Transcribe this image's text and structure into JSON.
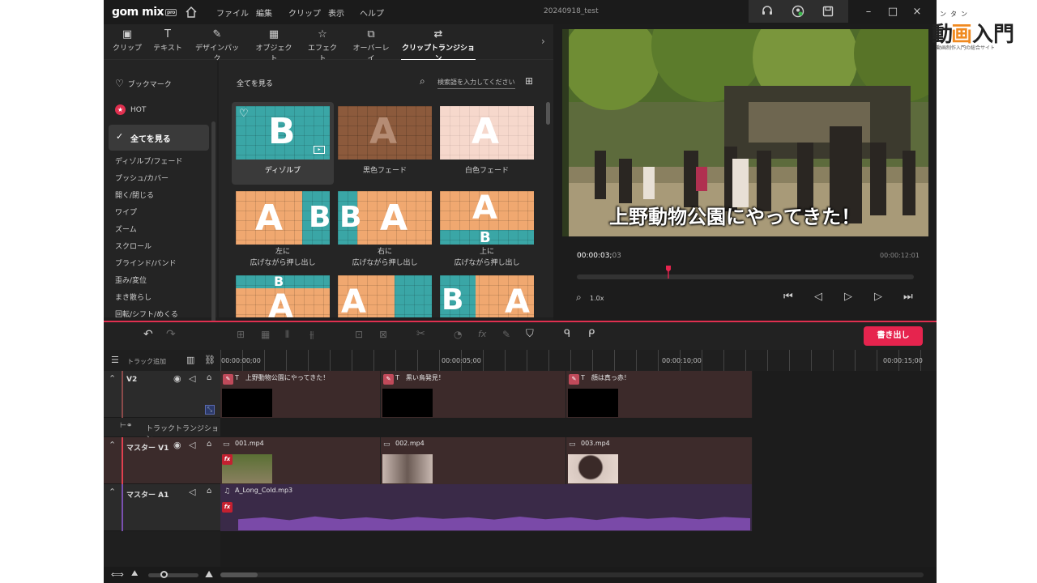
{
  "app": {
    "logo": "gom mix",
    "logo_badge": "pro",
    "project_name": "20240918_test"
  },
  "menu": [
    "ファイル",
    "編集",
    "クリップ",
    "表示",
    "ヘルプ"
  ],
  "tabs": [
    {
      "label": "クリップ",
      "icon": "clip-icon"
    },
    {
      "label": "テキスト",
      "icon": "text-icon"
    },
    {
      "label": "デザインパック",
      "icon": "design-pack-icon"
    },
    {
      "label": "オブジェクト",
      "icon": "object-icon"
    },
    {
      "label": "エフェクト",
      "icon": "effect-icon"
    },
    {
      "label": "オーバーレイ",
      "icon": "overlay-icon"
    },
    {
      "label": "クリップトランジション",
      "icon": "transition-icon"
    }
  ],
  "categories": {
    "bookmark": "ブックマーク",
    "hot": "HOT",
    "all": "全てを見る",
    "items": [
      "ディゾルブ/フェード",
      "プッシュ/カバー",
      "開く/閉じる",
      "ワイプ",
      "ズーム",
      "スクロール",
      "ブラインド/バンド",
      "歪み/変位",
      "まき散らし",
      "回転/シフト/めくる"
    ]
  },
  "grid": {
    "header": "全てを見る",
    "search_placeholder": "検索語を入力してください。",
    "items": [
      {
        "label": "ディゾルブ",
        "letter": "B"
      },
      {
        "label": "黒色フェード",
        "letter": "A"
      },
      {
        "label": "白色フェード",
        "letter": "A"
      },
      {
        "label": "左に\n広げながら押し出し",
        "line1": "左に",
        "line2": "広げながら押し出し"
      },
      {
        "label": "右に\n広げながら押し出し",
        "line1": "右に",
        "line2": "広げながら押し出し"
      },
      {
        "label": "上に\n広げながら押し出し",
        "line1": "上に",
        "line2": "広げながら押し出し"
      }
    ]
  },
  "preview": {
    "subtitle": "上野動物公園にやってきた！",
    "timecode_main": "00:00:03;",
    "timecode_frames": "03",
    "timecode_end": "00:00:12:01",
    "zoom": "1.0x"
  },
  "toolbar": {
    "export_label": "書き出し"
  },
  "timeline": {
    "add_track": "トラック追加",
    "ruler": [
      "00:00:00;00",
      "00:00:05;00",
      "00:00:10;00",
      "00:00:15;00"
    ],
    "tracks": {
      "v2": "V2",
      "transition": "トラックトランジション",
      "v1": "マスター V1",
      "a1": "マスター A1"
    },
    "text_clips": [
      "上野動物公園にやってきた！",
      "黒い鳥発見！",
      "顔は真っ赤！"
    ],
    "video_clips": [
      "001.mp4",
      "002.mp4",
      "003.mp4"
    ],
    "audio_clip": "A_Long_Cold.mp3"
  },
  "site": {
    "title_a": "動",
    "title_b": "画",
    "title_c": "入門",
    "ruby": "ンタン",
    "tagline": "動画制作入門の総合サイト"
  }
}
